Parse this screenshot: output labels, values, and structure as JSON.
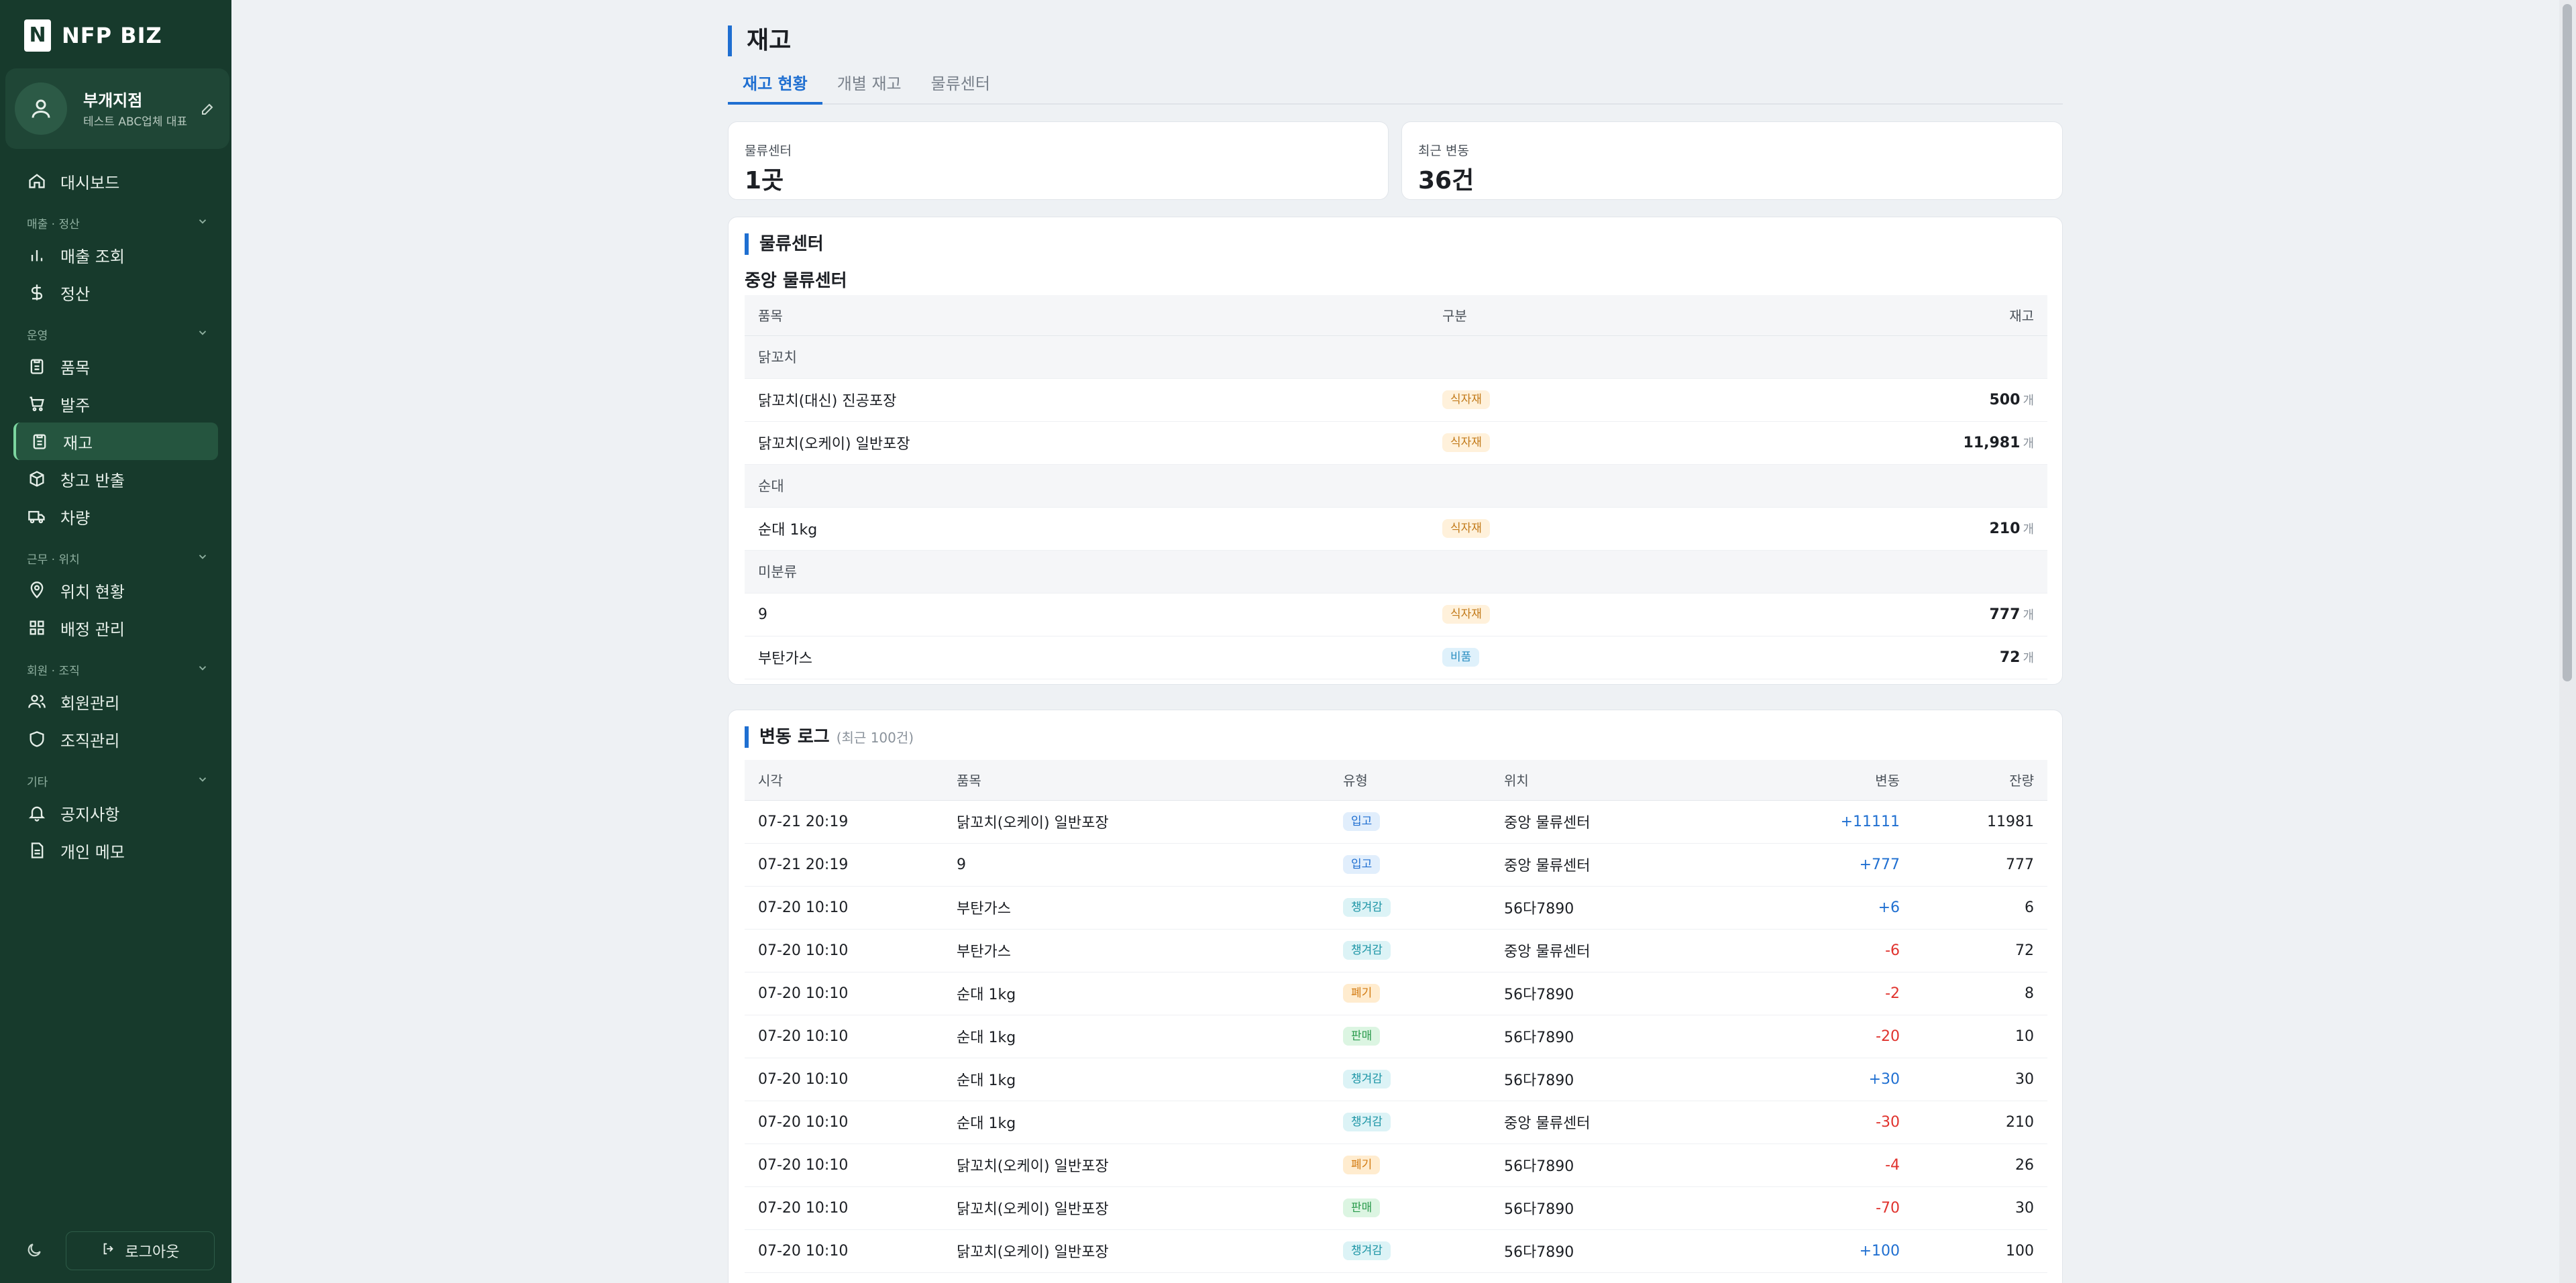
{
  "brand": {
    "logo_letter": "N",
    "name": "NFP BIZ"
  },
  "profile": {
    "name": "부개지점",
    "subtitle": "테스트 ABC업체 대표"
  },
  "nav": {
    "dashboard": "대시보드",
    "section_sales": "매출 · 정산",
    "sales_inquiry": "매출 조회",
    "settlement": "정산",
    "section_ops": "운영",
    "items": "품목",
    "orders": "발주",
    "inventory": "재고",
    "warehouse_return": "창고 반출",
    "vehicles": "차량",
    "section_work": "근무 · 위치",
    "location_status": "위치 현황",
    "assignment": "배정 관리",
    "section_members": "회원 · 조직",
    "member_mgmt": "회원관리",
    "org_mgmt": "조직관리",
    "section_etc": "기타",
    "notices": "공지사항",
    "personal_memo": "개인 메모"
  },
  "footer": {
    "logout": "로그아웃"
  },
  "page": {
    "title": "재고",
    "tabs": [
      "재고 현황",
      "개별 재고",
      "물류센터"
    ]
  },
  "stats": {
    "centers": {
      "label": "물류센터",
      "value": "1곳"
    },
    "recent": {
      "label": "최근 변동",
      "value": "36건"
    }
  },
  "centers_section": {
    "title": "물류센터",
    "center_name": "중앙 물류센터",
    "headers": {
      "item": "품목",
      "category": "구분",
      "stock": "재고"
    },
    "groups": [
      {
        "group": "닭꼬치",
        "rows": [
          {
            "item": "닭꼬치(대신) 진공포장",
            "category": "식자재",
            "type": "food",
            "qty": "500",
            "unit": "개"
          },
          {
            "item": "닭꼬치(오케이) 일반포장",
            "category": "식자재",
            "type": "food",
            "qty": "11,981",
            "unit": "개"
          }
        ]
      },
      {
        "group": "순대",
        "rows": [
          {
            "item": "순대 1kg",
            "category": "식자재",
            "type": "food",
            "qty": "210",
            "unit": "개"
          }
        ]
      },
      {
        "group": "미분류",
        "rows": [
          {
            "item": "9",
            "category": "식자재",
            "type": "food",
            "qty": "777",
            "unit": "개"
          },
          {
            "item": "부탄가스",
            "category": "비품",
            "type": "supply",
            "qty": "72",
            "unit": "개"
          }
        ]
      }
    ]
  },
  "log_section": {
    "title": "변동 로그",
    "subtitle": "(최근 100건)",
    "headers": {
      "time": "시각",
      "item": "품목",
      "type": "유형",
      "location": "위치",
      "change": "변동",
      "balance": "잔량"
    },
    "rows": [
      {
        "time": "07-21 20:19",
        "item": "닭꼬치(오케이) 일반포장",
        "type": "입고",
        "type_key": "in",
        "location": "중앙 물류센터",
        "change": "+11111",
        "sign": "pos",
        "balance": "11981"
      },
      {
        "time": "07-21 20:19",
        "item": "9",
        "type": "입고",
        "type_key": "in",
        "location": "중앙 물류센터",
        "change": "+777",
        "sign": "pos",
        "balance": "777"
      },
      {
        "time": "07-20 10:10",
        "item": "부탄가스",
        "type": "챙겨감",
        "type_key": "cold",
        "location": "56다7890",
        "change": "+6",
        "sign": "pos",
        "balance": "6"
      },
      {
        "time": "07-20 10:10",
        "item": "부탄가스",
        "type": "챙겨감",
        "type_key": "cold",
        "location": "중앙 물류센터",
        "change": "-6",
        "sign": "neg",
        "balance": "72"
      },
      {
        "time": "07-20 10:10",
        "item": "순대 1kg",
        "type": "폐기",
        "type_key": "waste",
        "location": "56다7890",
        "change": "-2",
        "sign": "neg",
        "balance": "8"
      },
      {
        "time": "07-20 10:10",
        "item": "순대 1kg",
        "type": "판매",
        "type_key": "sale",
        "location": "56다7890",
        "change": "-20",
        "sign": "neg",
        "balance": "10"
      },
      {
        "time": "07-20 10:10",
        "item": "순대 1kg",
        "type": "챙겨감",
        "type_key": "cold",
        "location": "56다7890",
        "change": "+30",
        "sign": "pos",
        "balance": "30"
      },
      {
        "time": "07-20 10:10",
        "item": "순대 1kg",
        "type": "챙겨감",
        "type_key": "cold",
        "location": "중앙 물류센터",
        "change": "-30",
        "sign": "neg",
        "balance": "210"
      },
      {
        "time": "07-20 10:10",
        "item": "닭꼬치(오케이) 일반포장",
        "type": "폐기",
        "type_key": "waste",
        "location": "56다7890",
        "change": "-4",
        "sign": "neg",
        "balance": "26"
      },
      {
        "time": "07-20 10:10",
        "item": "닭꼬치(오케이) 일반포장",
        "type": "판매",
        "type_key": "sale",
        "location": "56다7890",
        "change": "-70",
        "sign": "neg",
        "balance": "30"
      },
      {
        "time": "07-20 10:10",
        "item": "닭꼬치(오케이) 일반포장",
        "type": "챙겨감",
        "type_key": "cold",
        "location": "56다7890",
        "change": "+100",
        "sign": "pos",
        "balance": "100"
      }
    ]
  }
}
